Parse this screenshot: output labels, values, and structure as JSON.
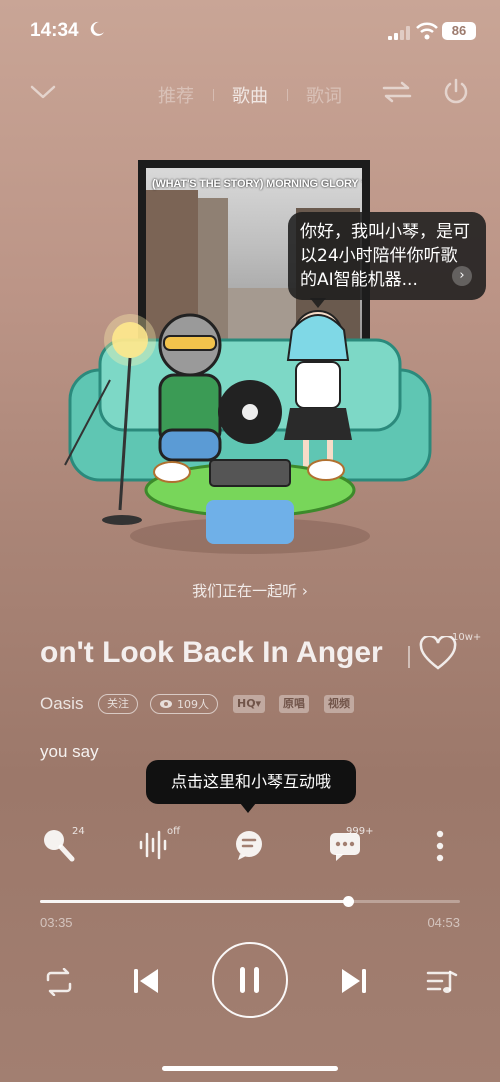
{
  "status_bar": {
    "time": "14:34",
    "battery": "86"
  },
  "header": {
    "tabs": [
      {
        "label": "推荐",
        "active": false
      },
      {
        "label": "歌曲",
        "active": true
      },
      {
        "label": "歌词",
        "active": false
      }
    ]
  },
  "album": {
    "title_text": "(WHAT'S THE STORY) MORNING GLORY ?"
  },
  "assistant": {
    "bubble_text": "你好，我叫小琴，是可以24小时陪伴你听歌的AI智能机器...",
    "bubble_more_icon": "chevron-right-icon"
  },
  "listen_together": {
    "label": "我们正在一起听 ›"
  },
  "song": {
    "title": "on't Look Back In Anger",
    "like_count": "10w+",
    "artist": "Oasis",
    "follow_label": "关注",
    "listeners": "109人",
    "quality_tag": "HQ▾",
    "tags": [
      "原唱",
      "视频"
    ]
  },
  "lyric": {
    "current": "you say"
  },
  "tooltip": {
    "text": "点击这里和小琴互动哦"
  },
  "controls": {
    "sing_count": "24",
    "effect_label": "off",
    "comment_count": "999+"
  },
  "progress": {
    "current": "03:35",
    "total": "04:53",
    "fraction": 0.733
  },
  "colors": {
    "background_top": "#c9a596",
    "background_bottom": "#9c786a",
    "tooltip_bg": "#111111"
  }
}
